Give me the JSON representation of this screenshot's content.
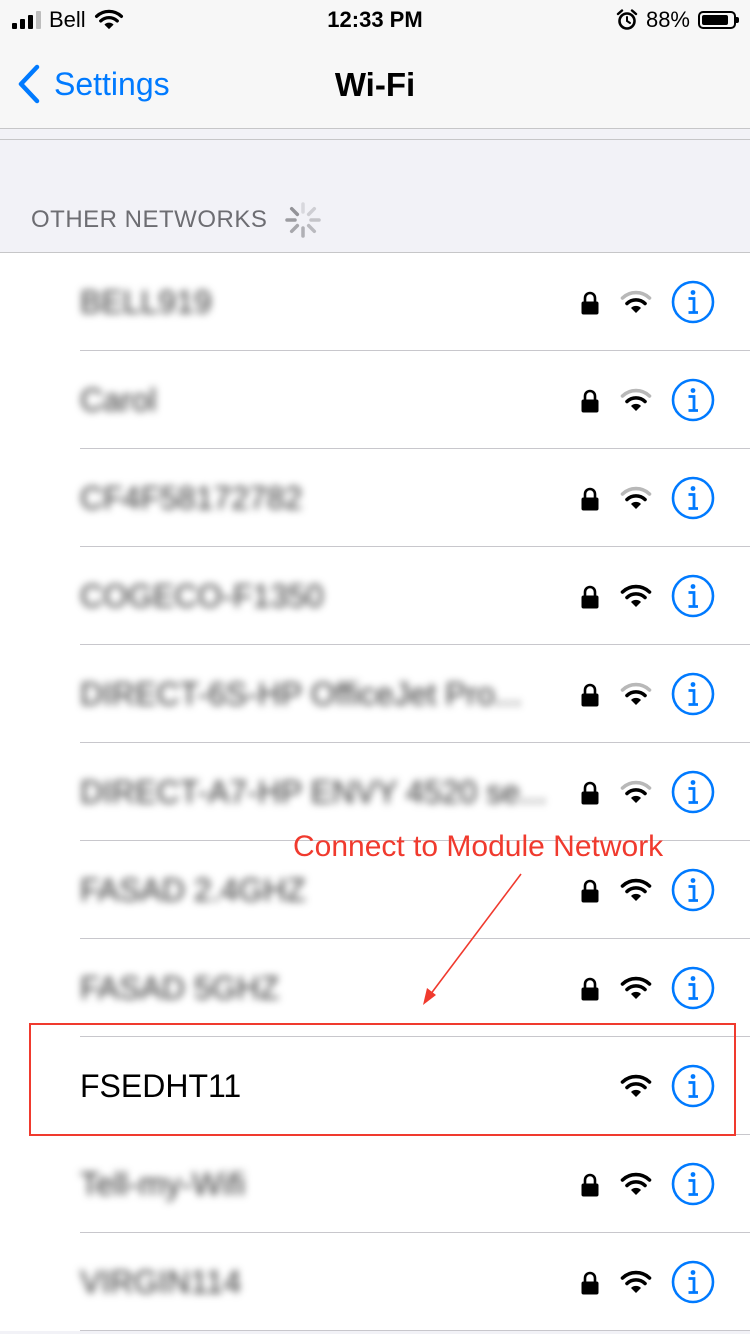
{
  "status_bar": {
    "carrier": "Bell",
    "time": "12:33 PM",
    "battery": "88%",
    "battery_level": 0.88
  },
  "nav": {
    "back_label": "Settings",
    "title": "Wi-Fi"
  },
  "section": {
    "header": "OTHER NETWORKS"
  },
  "networks": [
    {
      "name": "BELL919",
      "locked": true,
      "signal_bars": 2,
      "blurred": true
    },
    {
      "name": "Carol",
      "locked": true,
      "signal_bars": 2,
      "blurred": true
    },
    {
      "name": "CF4F58172782",
      "locked": true,
      "signal_bars": 2,
      "blurred": true
    },
    {
      "name": "COGECO-F1350",
      "locked": true,
      "signal_bars": 3,
      "blurred": true
    },
    {
      "name": "DIRECT-6S-HP OfficeJet Pro...",
      "locked": true,
      "signal_bars": 2,
      "blurred": true
    },
    {
      "name": "DIRECT-A7-HP ENVY 4520 se...",
      "locked": true,
      "signal_bars": 2,
      "blurred": true
    },
    {
      "name": "FASAD 2.4GHZ",
      "locked": true,
      "signal_bars": 3,
      "blurred": true
    },
    {
      "name": "FASAD 5GHZ",
      "locked": true,
      "signal_bars": 3,
      "blurred": true
    },
    {
      "name": "FSEDHT11",
      "locked": false,
      "signal_bars": 3,
      "blurred": false
    },
    {
      "name": "Tell-my-Wifi",
      "locked": true,
      "signal_bars": 3,
      "blurred": true
    },
    {
      "name": "VIRGIN114",
      "locked": true,
      "signal_bars": 3,
      "blurred": true
    }
  ],
  "annotation": {
    "text": "Connect to Module Network",
    "color": "#f03a2e"
  },
  "colors": {
    "accent": "#007aff",
    "wifi_dim": "#b8b8b8",
    "wifi_on": "#000000"
  },
  "icons": {
    "lock": "lock-icon",
    "wifi": "wifi-icon",
    "info": "info-icon",
    "back": "chevron-left-icon",
    "spinner": "activity-spinner-icon"
  }
}
